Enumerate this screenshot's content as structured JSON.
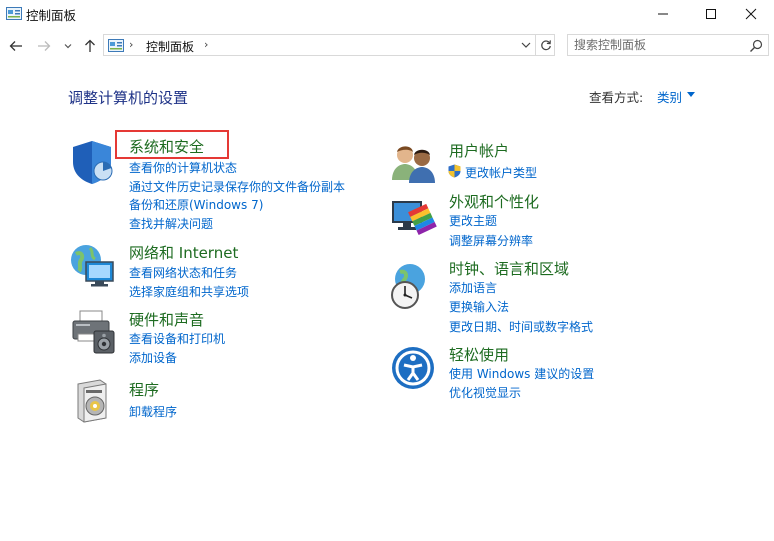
{
  "window": {
    "title": "控制面板",
    "icons": {
      "app": "control-panel-icon",
      "minimize": "minimize-icon",
      "maximize": "maximize-icon",
      "close": "close-icon"
    }
  },
  "nav": {
    "icons": {
      "back": "arrow-left-icon",
      "forward": "arrow-right-icon",
      "recent": "chevron-down-icon",
      "up": "arrow-up-icon"
    },
    "breadcrumb": [
      "控制面板"
    ],
    "search_placeholder": "搜索控制面板"
  },
  "main": {
    "heading": "调整计算机的设置",
    "view_by_label": "查看方式:",
    "view_by_value": "类别"
  },
  "categories_left": [
    {
      "icon": "shield-icon",
      "title": "系统和安全",
      "highlighted": true,
      "links": [
        "查看你的计算机状态",
        "通过文件历史记录保存你的文件备份副本",
        "备份和还原(Windows 7)",
        "查找并解决问题"
      ]
    },
    {
      "icon": "network-globe-icon",
      "title": "网络和 Internet",
      "links": [
        "查看网络状态和任务",
        "选择家庭组和共享选项"
      ]
    },
    {
      "icon": "printer-icon",
      "title": "硬件和声音",
      "links": [
        "查看设备和打印机",
        "添加设备"
      ]
    },
    {
      "icon": "program-disc-icon",
      "title": "程序",
      "links": [
        "卸载程序"
      ]
    }
  ],
  "categories_right": [
    {
      "icon": "users-icon",
      "title": "用户帐户",
      "links": [
        "更改帐户类型"
      ],
      "link_icons": [
        "uac-shield-icon"
      ]
    },
    {
      "icon": "appearance-monitor-icon",
      "title": "外观和个性化",
      "links": [
        "更改主题",
        "调整屏幕分辨率"
      ]
    },
    {
      "icon": "clock-globe-icon",
      "title": "时钟、语言和区域",
      "links": [
        "添加语言",
        "更换输入法",
        "更改日期、时间或数字格式"
      ]
    },
    {
      "icon": "ease-of-access-icon",
      "title": "轻松使用",
      "links": [
        "使用 Windows 建议的设置",
        "优化视觉显示"
      ]
    }
  ],
  "colors": {
    "heading": "#1e3287",
    "category_title": "#1d6b20",
    "link": "#0066cc",
    "highlight_box": "#e53935"
  }
}
